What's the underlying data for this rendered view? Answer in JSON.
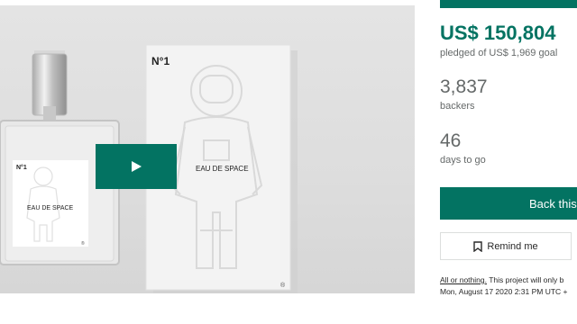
{
  "media": {
    "box_brand": "N°1",
    "box_label": "EAU  DE  SPACE",
    "bottle_brand": "N°1",
    "bottle_label": "EAU  DE  SPACE",
    "registered_mark": "®",
    "play_icon": "play-icon",
    "colors": {
      "accent": "#037362",
      "bg": "#e0e0e0"
    }
  },
  "funding": {
    "pledged_amount": "US$ 150,804",
    "pledged_goal_text": "pledged of US$ 1,969 goal",
    "backers_count": "3,837",
    "backers_label": "backers",
    "days_count": "46",
    "days_label": "days to go",
    "progress_fraction": 1.0
  },
  "actions": {
    "back_label": "Back this",
    "remind_label": "Remind me",
    "remind_icon": "bookmark-icon"
  },
  "note": {
    "link_text": "All or nothing.",
    "line1_rest": " This project will only b",
    "line2": "Mon, August 17 2020 2:31 PM UTC +"
  },
  "colors": {
    "green": "#037362",
    "text_muted": "#656969"
  }
}
